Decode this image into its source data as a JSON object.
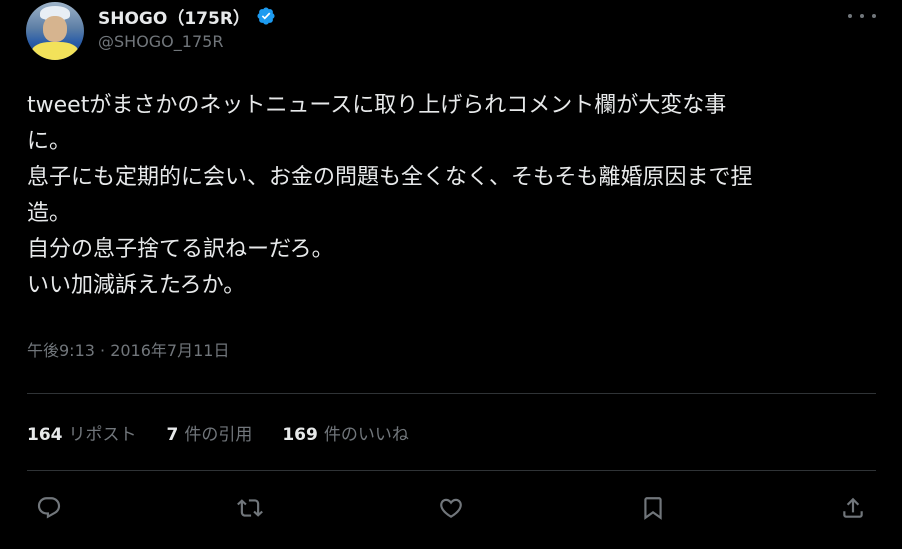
{
  "user": {
    "display_name": "SHOGO（175R）",
    "handle": "@SHOGO_175R"
  },
  "tweet": {
    "lines": [
      "tweetがまさかのネットニュースに取り上げられコメント欄が大変な事",
      "に。",
      "息子にも定期的に会い、お金の問題も全くなく、そもそも離婚原因まで捏",
      "造。",
      "自分の息子捨てる訳ねーだろ。",
      "いい加減訴えたろか。"
    ],
    "timestamp": "午後9:13 · 2016年7月11日"
  },
  "stats": {
    "reposts": {
      "count": "164",
      "label": "リポスト"
    },
    "quotes": {
      "count": "7",
      "label": "件の引用"
    },
    "likes": {
      "count": "169",
      "label": "件のいいね"
    }
  },
  "icons": {
    "verified": "verified-badge-icon",
    "more": "more-icon",
    "reply": "reply-icon",
    "repost": "repost-icon",
    "like": "like-icon",
    "bookmark": "bookmark-icon",
    "share": "share-icon"
  },
  "colors": {
    "background": "#000000",
    "text_primary": "#e7e9ea",
    "text_secondary": "#71767b",
    "divider": "#2f3336",
    "verified": "#1d9bf0"
  }
}
